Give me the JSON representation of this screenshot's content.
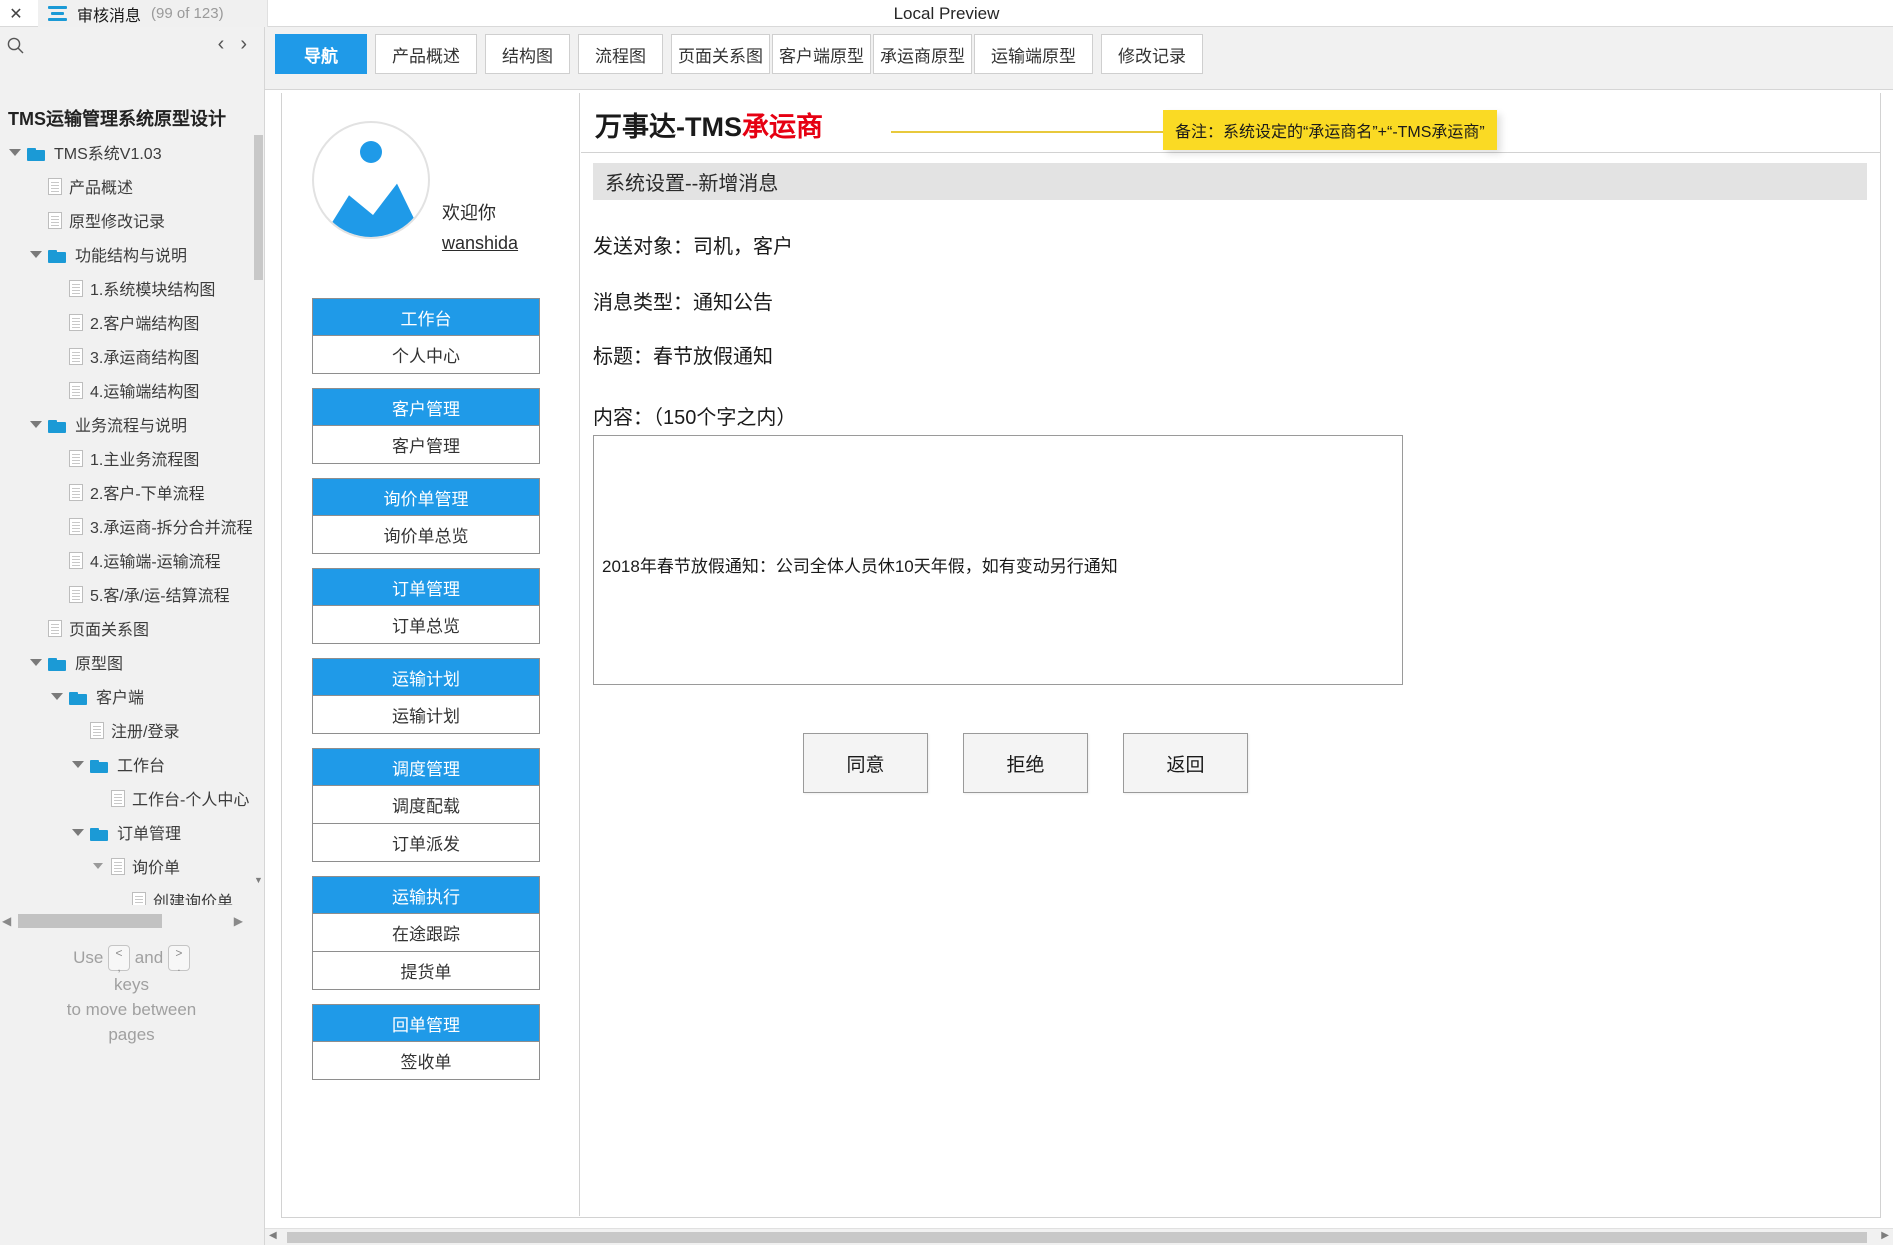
{
  "window": {
    "close_label": "✕",
    "preview_title": "Local Preview",
    "page_tab": {
      "title": "审核消息",
      "count": "(99 of 123)"
    }
  },
  "sidebar": {
    "prev_label": "‹",
    "next_label": "›",
    "project_title": "TMS运输管理系统原型设计",
    "hint": {
      "use": "Use",
      "key_left": "<",
      "key_left_sub": ",",
      "and": "and",
      "key_right": ">",
      "key_right_sub": ".",
      "line2": "keys",
      "line3": "to move between",
      "line4": "pages"
    },
    "tree": [
      {
        "label": "TMS系统V1.03",
        "icon": "folder-icon",
        "indent": 0,
        "caret": "open"
      },
      {
        "label": "产品概述",
        "icon": "page-icon",
        "indent": 1,
        "caret": "none"
      },
      {
        "label": "原型修改记录",
        "icon": "page-icon",
        "indent": 1,
        "caret": "none"
      },
      {
        "label": "功能结构与说明",
        "icon": "folder-icon",
        "indent": 1,
        "caret": "open"
      },
      {
        "label": "1.系统模块结构图",
        "icon": "page-icon",
        "indent": 2,
        "caret": "none"
      },
      {
        "label": "2.客户端结构图",
        "icon": "page-icon",
        "indent": 2,
        "caret": "none"
      },
      {
        "label": "3.承运商结构图",
        "icon": "page-icon",
        "indent": 2,
        "caret": "none"
      },
      {
        "label": "4.运输端结构图",
        "icon": "page-icon",
        "indent": 2,
        "caret": "none"
      },
      {
        "label": "业务流程与说明",
        "icon": "folder-icon",
        "indent": 1,
        "caret": "open"
      },
      {
        "label": "1.主业务流程图",
        "icon": "page-icon",
        "indent": 2,
        "caret": "none"
      },
      {
        "label": "2.客户-下单流程",
        "icon": "page-icon",
        "indent": 2,
        "caret": "none"
      },
      {
        "label": "3.承运商-拆分合并流程",
        "icon": "page-icon",
        "indent": 2,
        "caret": "none"
      },
      {
        "label": "4.运输端-运输流程",
        "icon": "page-icon",
        "indent": 2,
        "caret": "none"
      },
      {
        "label": "5.客/承/运-结算流程",
        "icon": "page-icon",
        "indent": 2,
        "caret": "none"
      },
      {
        "label": "页面关系图",
        "icon": "page-icon",
        "indent": 1,
        "caret": "none"
      },
      {
        "label": "原型图",
        "icon": "folder-icon",
        "indent": 1,
        "caret": "open"
      },
      {
        "label": "客户端",
        "icon": "folder-icon",
        "indent": 2,
        "caret": "open"
      },
      {
        "label": "注册/登录",
        "icon": "page-icon",
        "indent": 3,
        "caret": "none"
      },
      {
        "label": "工作台",
        "icon": "folder-icon",
        "indent": 3,
        "caret": "open"
      },
      {
        "label": "工作台-个人中心",
        "icon": "page-icon",
        "indent": 4,
        "caret": "none"
      },
      {
        "label": "订单管理",
        "icon": "folder-icon",
        "indent": 3,
        "caret": "open"
      },
      {
        "label": "询价单",
        "icon": "page-icon",
        "indent": 4,
        "caret": "open"
      },
      {
        "label": "创建询价单",
        "icon": "page-icon",
        "indent": 5,
        "caret": "none"
      }
    ]
  },
  "tabstrip": {
    "tabs": [
      {
        "label": "导航",
        "active": true
      },
      {
        "label": "产品概述",
        "active": false
      },
      {
        "label": "结构图",
        "active": false
      },
      {
        "label": "流程图",
        "active": false
      },
      {
        "label": "页面关系图",
        "active": false
      },
      {
        "label": "客户端原型",
        "active": false
      },
      {
        "label": "承运商原型",
        "active": false
      },
      {
        "label": "运输端原型",
        "active": false
      },
      {
        "label": "修改记录",
        "active": false
      }
    ]
  },
  "prototype": {
    "brand_prefix": "万事达-TMS",
    "brand_highlight": "承运商",
    "note": "备注：系统设定的“承运商名”+“-TMS承运商”",
    "welcome": "欢迎你",
    "username": "wanshida",
    "section_title": "系统设置--新增消息",
    "fields": {
      "recipient": "发送对象：司机，客户",
      "msg_type": "消息类型：通知公告",
      "title": "标题：春节放假通知",
      "content_label": "内容：（150个字之内）",
      "content_value": "2018年春节放假通知：公司全体人员休10天年假，如有变动另行通知"
    },
    "buttons": [
      {
        "label": "同意"
      },
      {
        "label": "拒绝"
      },
      {
        "label": "返回"
      }
    ],
    "menu": [
      {
        "head": "工作台",
        "items": [
          "个人中心"
        ]
      },
      {
        "head": "客户管理",
        "items": [
          "客户管理"
        ]
      },
      {
        "head": "询价单管理",
        "items": [
          "询价单总览"
        ]
      },
      {
        "head": "订单管理",
        "items": [
          "订单总览"
        ]
      },
      {
        "head": "运输计划",
        "items": [
          "运输计划"
        ]
      },
      {
        "head": "调度管理",
        "items": [
          "调度配载",
          "订单派发"
        ]
      },
      {
        "head": "运输执行",
        "items": [
          "在途跟踪",
          "提货单"
        ]
      },
      {
        "head": "回单管理",
        "items": [
          "签收单"
        ]
      }
    ]
  },
  "colors": {
    "accent": "#1f9ae8",
    "note_bg": "#fada24",
    "brand_red": "#e60012",
    "section_bg": "#e3e3e3"
  }
}
